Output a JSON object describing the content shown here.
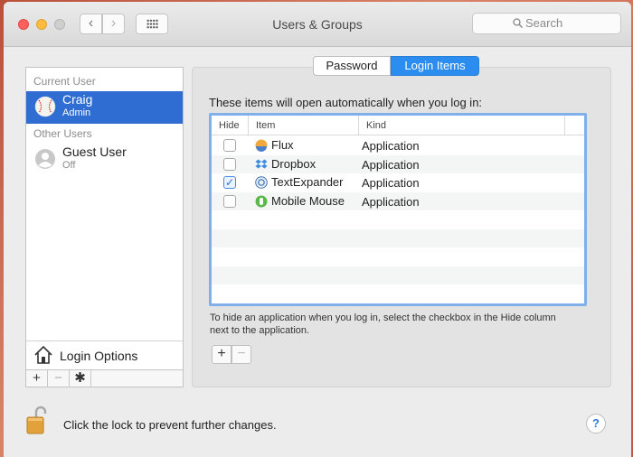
{
  "window": {
    "title": "Users & Groups"
  },
  "toolbar": {
    "back_glyph": "‹",
    "forward_glyph": "›",
    "search_placeholder": "Search"
  },
  "sidebar": {
    "current_user_label": "Current User",
    "other_users_label": "Other Users",
    "current_user": {
      "name": "Craig",
      "role": "Admin",
      "avatar_icon": "baseball-icon"
    },
    "other_users": [
      {
        "name": "Guest User",
        "status": "Off",
        "avatar_icon": "person-silhouette-icon"
      }
    ],
    "login_options_label": "Login Options",
    "tools": {
      "add": "+",
      "remove": "−",
      "settings": "✱"
    }
  },
  "tabs": [
    {
      "label": "Password"
    },
    {
      "label": "Login Items",
      "selected": true
    }
  ],
  "login_items": {
    "heading": "These items will open automatically when you log in:",
    "columns": [
      "Hide",
      "Item",
      "Kind"
    ],
    "rows": [
      {
        "hide": false,
        "item": "Flux",
        "kind": "Application",
        "icon": "flux-icon"
      },
      {
        "hide": false,
        "item": "Dropbox",
        "kind": "Application",
        "icon": "dropbox-icon"
      },
      {
        "hide": true,
        "item": "TextExpander",
        "kind": "Application",
        "icon": "textexpander-icon"
      },
      {
        "hide": false,
        "item": "Mobile Mouse",
        "kind": "Application",
        "icon": "mobile-mouse-icon"
      }
    ],
    "help_text": "To hide an application when you log in, select the checkbox in the Hide column next to the application.",
    "add_label": "+",
    "remove_label": "−"
  },
  "footer": {
    "lock_text": "Click the lock to prevent further changes.",
    "help_label": "?"
  },
  "colors": {
    "selection": "#2f6dd3",
    "tab_selected": "#2b8df0",
    "table_focus": "#7fb0ea"
  }
}
